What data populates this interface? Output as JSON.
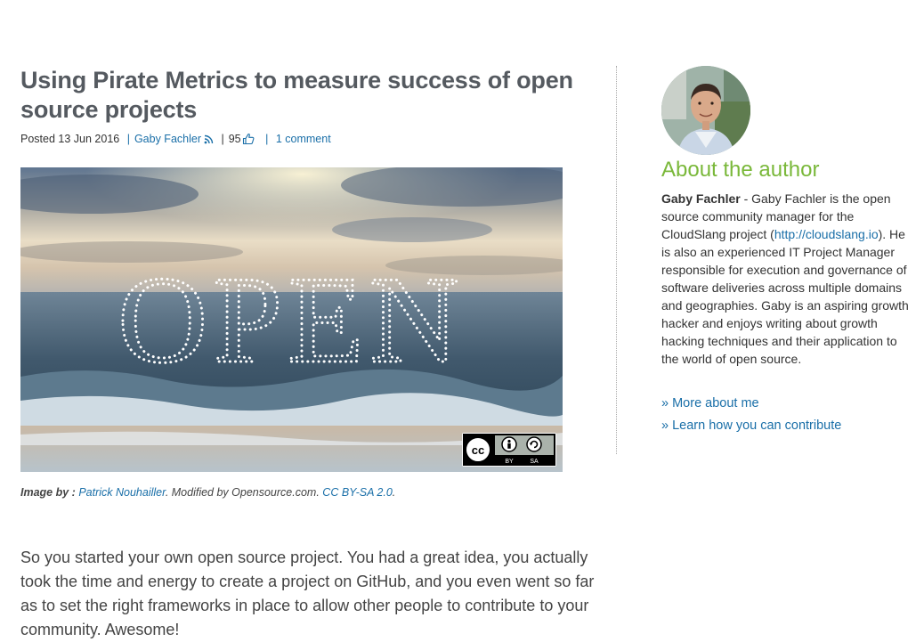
{
  "article": {
    "title": "Using Pirate Metrics to measure success of open source projects",
    "meta": {
      "posted_label": "Posted",
      "date": "13 Jun 2016",
      "separator": "|",
      "author": "Gaby Fachler",
      "likes": "95",
      "comments": "1 comment"
    },
    "hero_image": {
      "overlay_text": "OPEN",
      "license_badge": {
        "cc": "cc",
        "by": "BY",
        "sa": "SA"
      }
    },
    "caption": {
      "prefix": "Image by :",
      "photographer": "Patrick Nouhailler",
      "middle": ". Modified by Opensource.com. ",
      "license": "CC BY-SA 2.0",
      "suffix": "."
    },
    "body": "So you started your own open source project. You had a great idea, you actually took the time and energy to create a project on GitHub, and you even went so far as to set the right frameworks in place to allow other people to contribute to your community. Awesome!"
  },
  "sidebar": {
    "heading": "About the author",
    "bio": {
      "name": "Gaby Fachler",
      "text_before_link": " - Gaby Fachler is the open source community manager for the CloudSlang project (",
      "link": "http://cloudslang.io",
      "text_after_link": "). He is also an experienced IT Project Manager responsible for execution and governance of software deliveries across multiple domains and geographies. Gaby is an aspiring growth hacker and enjoys writing about growth hacking techniques and their application to the world of open source."
    },
    "links": [
      "» More about me",
      "» Learn how you can contribute"
    ]
  },
  "colors": {
    "title": "#555a60",
    "link": "#1a6fa8",
    "sidebar_heading": "#7ab83a"
  },
  "icons": [
    "rss-icon",
    "thumbs-up-icon",
    "cc-icon",
    "by-icon",
    "sa-icon"
  ]
}
